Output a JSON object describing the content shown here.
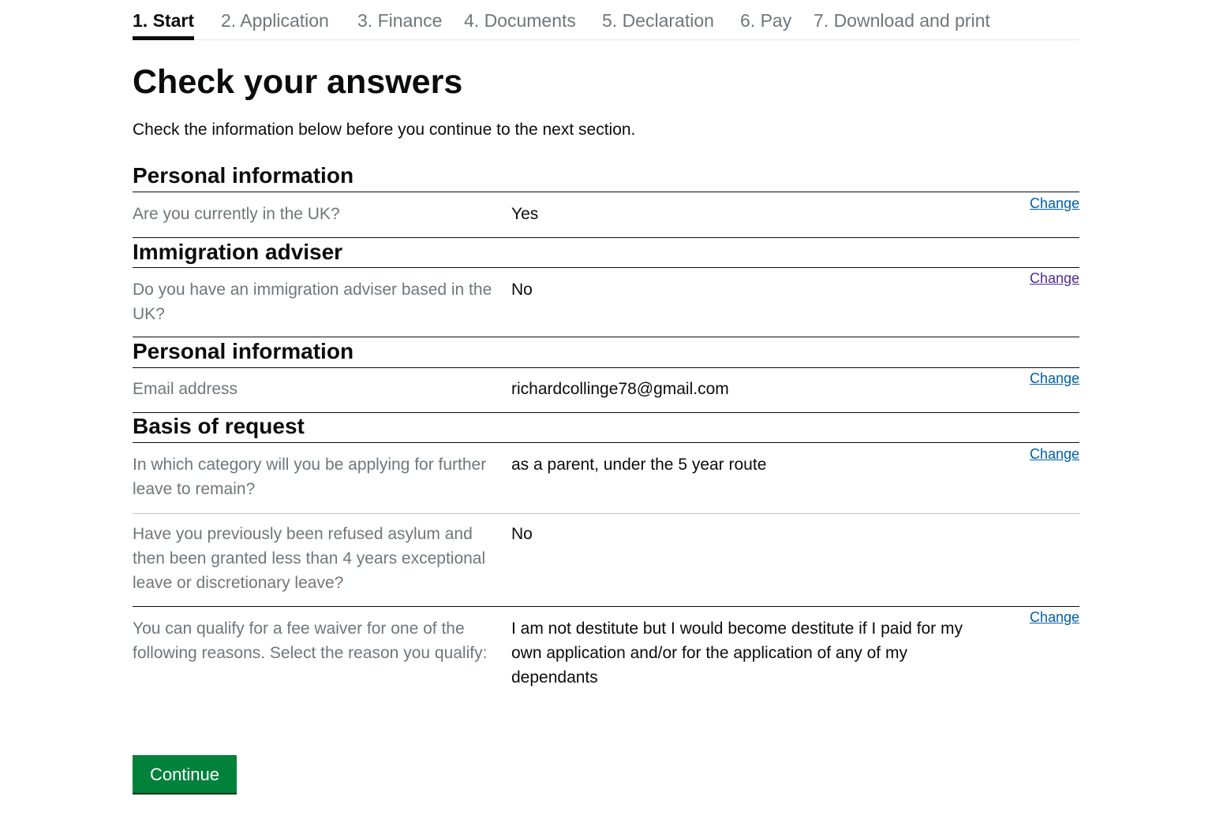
{
  "steps": [
    {
      "label": "1. Start",
      "active": true
    },
    {
      "label": "2. Application"
    },
    {
      "label": "3. Finance"
    },
    {
      "label": "4. Documents"
    },
    {
      "label": "5. Declaration"
    },
    {
      "label": "6. Pay"
    },
    {
      "label": "7. Download and print"
    }
  ],
  "page": {
    "title": "Check your answers",
    "lead": "Check the information below before you continue to the next section."
  },
  "sections": [
    {
      "title": "Personal information",
      "rows": [
        {
          "question": "Are you currently in the UK?",
          "answer": "Yes",
          "change": "Change"
        }
      ]
    },
    {
      "title": "Immigration adviser",
      "rows": [
        {
          "question": "Do you have an immigration adviser based in the UK?",
          "answer": "No",
          "change": "Change"
        }
      ]
    },
    {
      "title": "Personal information",
      "rows": [
        {
          "question": "Email address",
          "answer": "richardcollinge78@gmail.com",
          "change": "Change"
        }
      ]
    },
    {
      "title": "Basis of request",
      "rows": [
        {
          "question": "In which category will you be applying for further leave to remain?",
          "answer": "as a parent, under the 5 year route",
          "change": "Change"
        },
        {
          "question": "Have you previously been refused asylum and then been granted less than 4 years exceptional leave or discretionary leave?",
          "answer": "No"
        },
        {
          "question": "You can qualify for a fee waiver for one of the following reasons. Select the reason you qualify:",
          "answer": "I am not destitute but I would become destitute if I paid for my own application and/or for the application of any of my dependants",
          "change": "Change"
        }
      ]
    }
  ],
  "actions": {
    "continue_label": "Continue"
  },
  "colors": {
    "text": "#0b0c0c",
    "secondary_text": "#6f777b",
    "link": "#005ea5",
    "link_visited": "#4c2c92",
    "button": "#00823b"
  }
}
